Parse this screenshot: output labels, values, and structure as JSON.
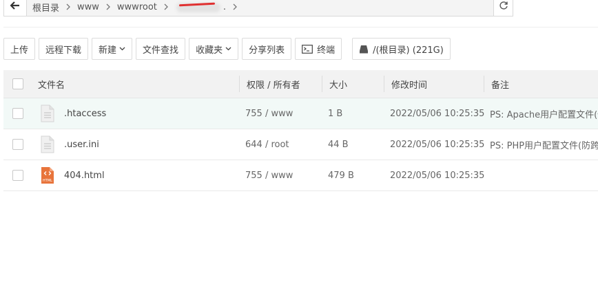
{
  "breadcrumb": {
    "items": [
      "根目录",
      "www",
      "wwwroot",
      "."
    ]
  },
  "toolbar": {
    "buttons": [
      {
        "label": "上传"
      },
      {
        "label": "远程下载"
      },
      {
        "label": "新建"
      },
      {
        "label": "文件查找"
      },
      {
        "label": "收藏夹"
      },
      {
        "label": "分享列表"
      },
      {
        "label": "终端"
      },
      {
        "label": "/(根目录) (221G)"
      }
    ]
  },
  "table": {
    "headers": {
      "name": "文件名",
      "perm": "权限 / 所有者",
      "size": "大小",
      "mtime": "修改时间",
      "note": "备注"
    },
    "rows": [
      {
        "name": ".htaccess",
        "perm": "755 / www",
        "size": "1 B",
        "mtime": "2022/05/06 10:25:35",
        "note": "PS: Apache用户配置文件(伪静态)",
        "icon": "text-file-icon"
      },
      {
        "name": ".user.ini",
        "perm": "644 / root",
        "size": "44 B",
        "mtime": "2022/05/06 10:25:35",
        "note": "PS: PHP用户配置文件(防跨站)",
        "icon": "text-file-icon"
      },
      {
        "name": "404.html",
        "perm": "755 / www",
        "size": "479 B",
        "mtime": "2022/05/06 10:25:35",
        "note": "",
        "icon": "html-file-icon"
      }
    ]
  },
  "colors": {
    "highlight_row": "#f2f9f7",
    "header_bg": "#f2f2f2",
    "html_icon": "#e8743b",
    "redaction_mark": "#e03030"
  }
}
